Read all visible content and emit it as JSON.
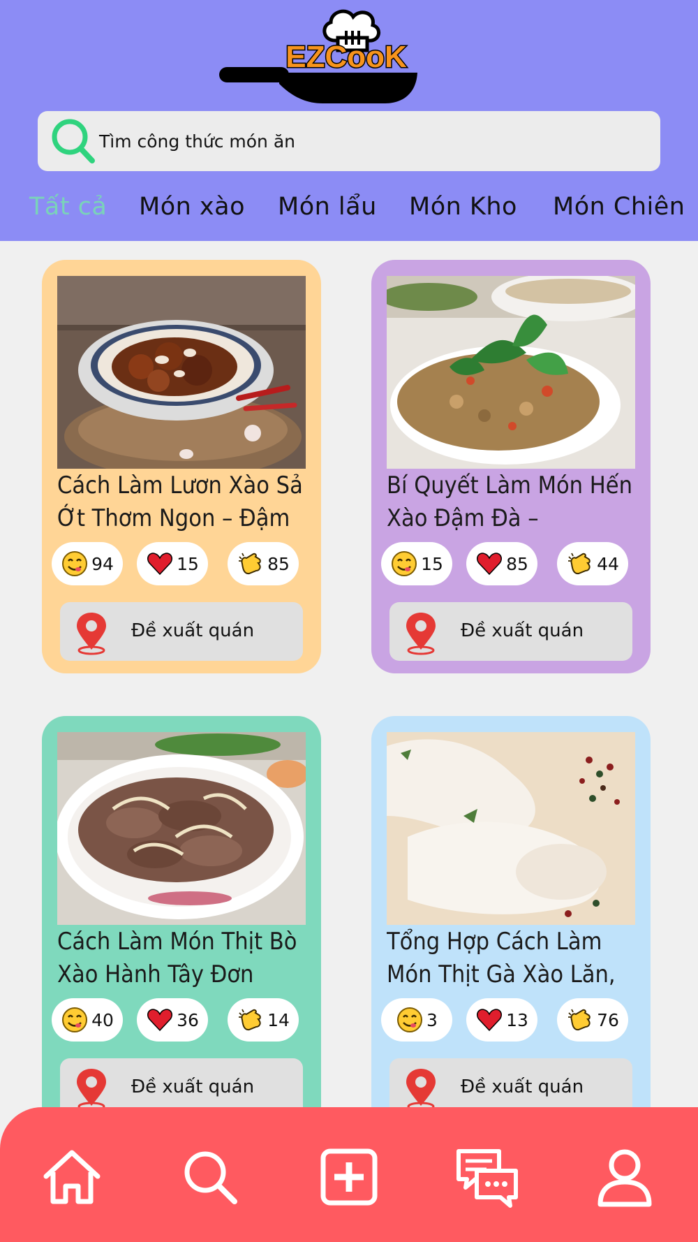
{
  "app": {
    "logo_text": "EZCooK"
  },
  "search": {
    "placeholder": "Tìm công thức món ăn"
  },
  "tabs": [
    {
      "label": "Tất cả",
      "active": true
    },
    {
      "label": "Món xào",
      "active": false
    },
    {
      "label": "Món lẩu",
      "active": false
    },
    {
      "label": "Món Kho",
      "active": false
    },
    {
      "label": "Món Chiên",
      "active": false
    }
  ],
  "colors": {
    "header": "#8c8cf5",
    "active_tab": "#7ad3b9",
    "nav": "#ff5a60",
    "card_1": "#ffd596",
    "card_2": "#c9a4e3",
    "card_3": "#7fd9bd",
    "card_4": "#bfe2fa"
  },
  "cards": [
    {
      "title": "Cách Làm Lươn Xào Sả Ớt Thơm Ngon – Đậm",
      "yum": "94",
      "love": "15",
      "clap": "85",
      "suggest_label": "Đề xuất quán",
      "image": "stir-fried-eel-photo"
    },
    {
      "title": "Bí Quyết Làm Món Hến Xào Đậm Đà –",
      "yum": "15",
      "love": "85",
      "clap": "44",
      "suggest_label": "Đề xuất quán",
      "image": "stir-fried-clams-photo"
    },
    {
      "title": "Cách Làm Món Thịt Bò Xào Hành Tây Đơn",
      "yum": "40",
      "love": "36",
      "clap": "14",
      "suggest_label": "Đề xuất quán",
      "image": "beef-onion-photo"
    },
    {
      "title": "Tổng Hợp Cách Làm Món Thịt Gà Xào Lăn,",
      "yum": "3",
      "love": "13",
      "clap": "76",
      "suggest_label": "Đề xuất quán",
      "image": "raw-chicken-photo"
    }
  ],
  "nav": [
    {
      "icon": "home-icon"
    },
    {
      "icon": "search-icon"
    },
    {
      "icon": "add-post-icon"
    },
    {
      "icon": "chat-icon"
    },
    {
      "icon": "profile-icon"
    }
  ]
}
